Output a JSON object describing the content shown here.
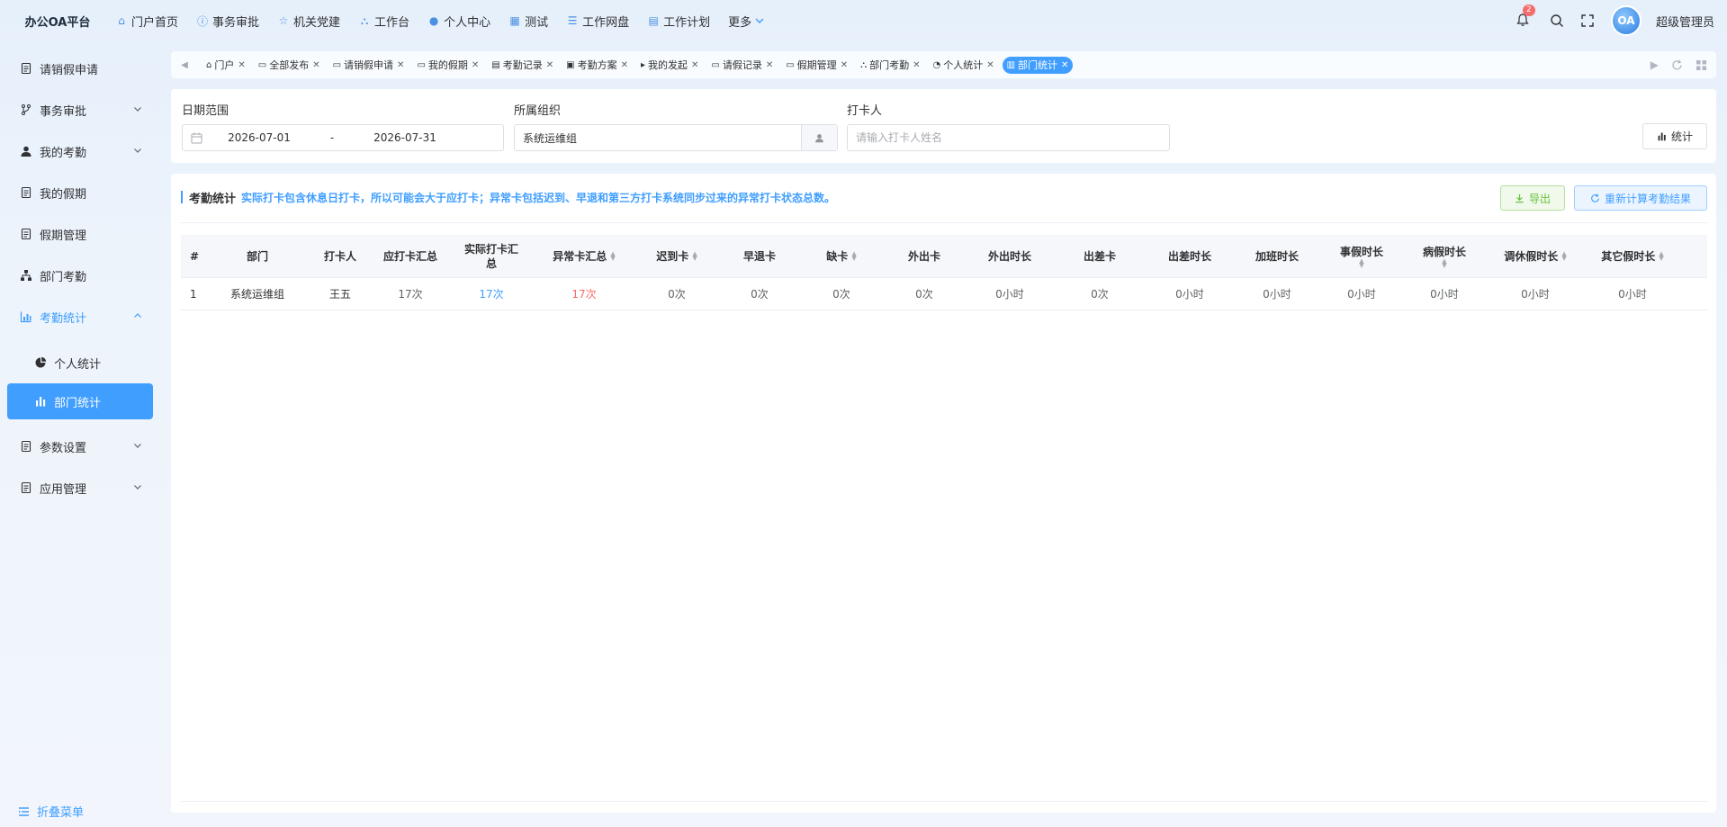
{
  "app": {
    "brand": "办公OA平台"
  },
  "topnav": [
    {
      "icon": "home-icon",
      "glyph": "⌂",
      "label": "门户首页"
    },
    {
      "icon": "info-icon",
      "glyph": "ⓘ",
      "label": "事务审批"
    },
    {
      "icon": "star-icon",
      "glyph": "☆",
      "label": "机关党建"
    },
    {
      "icon": "sitemap-icon",
      "glyph": "⛬",
      "label": "工作台"
    },
    {
      "icon": "user-icon",
      "glyph": "●",
      "label": "个人中心"
    },
    {
      "icon": "grid-icon",
      "glyph": "▦",
      "label": "测试"
    },
    {
      "icon": "database-icon",
      "glyph": "☰",
      "label": "工作网盘"
    },
    {
      "icon": "calendar-icon",
      "glyph": "▤",
      "label": "工作计划"
    },
    {
      "icon": "",
      "glyph": "",
      "label": "更多"
    }
  ],
  "header": {
    "notification_count": "2",
    "avatar_text": "OA",
    "username": "超级管理员"
  },
  "sidebar": {
    "items": [
      {
        "label": "请销假申请"
      },
      {
        "label": "事务审批"
      },
      {
        "label": "我的考勤"
      },
      {
        "label": "我的假期"
      },
      {
        "label": "假期管理"
      },
      {
        "label": "部门考勤"
      },
      {
        "label": "考勤统计"
      },
      {
        "label": "个人统计"
      },
      {
        "label": "部门统计"
      },
      {
        "label": "参数设置"
      },
      {
        "label": "应用管理"
      }
    ],
    "collapse_label": "折叠菜单"
  },
  "tabs": [
    {
      "label": "门户",
      "glyph": "⌂"
    },
    {
      "label": "全部发布",
      "glyph": "▭"
    },
    {
      "label": "请销假申请",
      "glyph": "▭"
    },
    {
      "label": "我的假期",
      "glyph": "▭"
    },
    {
      "label": "考勤记录",
      "glyph": "▤"
    },
    {
      "label": "考勤方案",
      "glyph": "▣"
    },
    {
      "label": "我的发起",
      "glyph": "▸"
    },
    {
      "label": "请假记录",
      "glyph": "▭"
    },
    {
      "label": "假期管理",
      "glyph": "▭"
    },
    {
      "label": "部门考勤",
      "glyph": "⛬"
    },
    {
      "label": "个人统计",
      "glyph": "◔"
    },
    {
      "label": "部门统计",
      "glyph": "▥"
    }
  ],
  "filter": {
    "date_label": "日期范围",
    "date_start": "2026-07-01",
    "date_sep": "-",
    "date_end": "2026-07-31",
    "org_label": "所属组织",
    "org_value": "系统运维组",
    "punch_label": "打卡人",
    "punch_placeholder": "请输入打卡人姓名",
    "stat_button": "统计"
  },
  "card": {
    "title": "考勤统计",
    "note": "实际打卡包含休息日打卡，所以可能会大于应打卡；异常卡包括迟到、早退和第三方打卡系统同步过来的异常打卡状态总数。",
    "export_button": "导出",
    "recalc_button": "重新计算考勤结果"
  },
  "table": {
    "columns": [
      "#",
      "部门",
      "打卡人",
      "应打卡汇总",
      "实际打卡汇总",
      "异常卡汇总",
      "迟到卡",
      "早退卡",
      "缺卡",
      "外出卡",
      "外出时长",
      "出差卡",
      "出差时长",
      "加班时长",
      "事假时长",
      "病假时长",
      "调休假时长",
      "其它假时长"
    ],
    "rows": [
      [
        "1",
        "系统运维组",
        "王五",
        "17次",
        "17次",
        "17次",
        "0次",
        "0次",
        "0次",
        "0次",
        "0小时",
        "0次",
        "0小时",
        "0小时",
        "0小时",
        "0小时",
        "0小时",
        "0小时"
      ]
    ]
  },
  "colors": {
    "accent": "#409eff",
    "danger": "#f56c6c",
    "success": "#67c23a"
  }
}
